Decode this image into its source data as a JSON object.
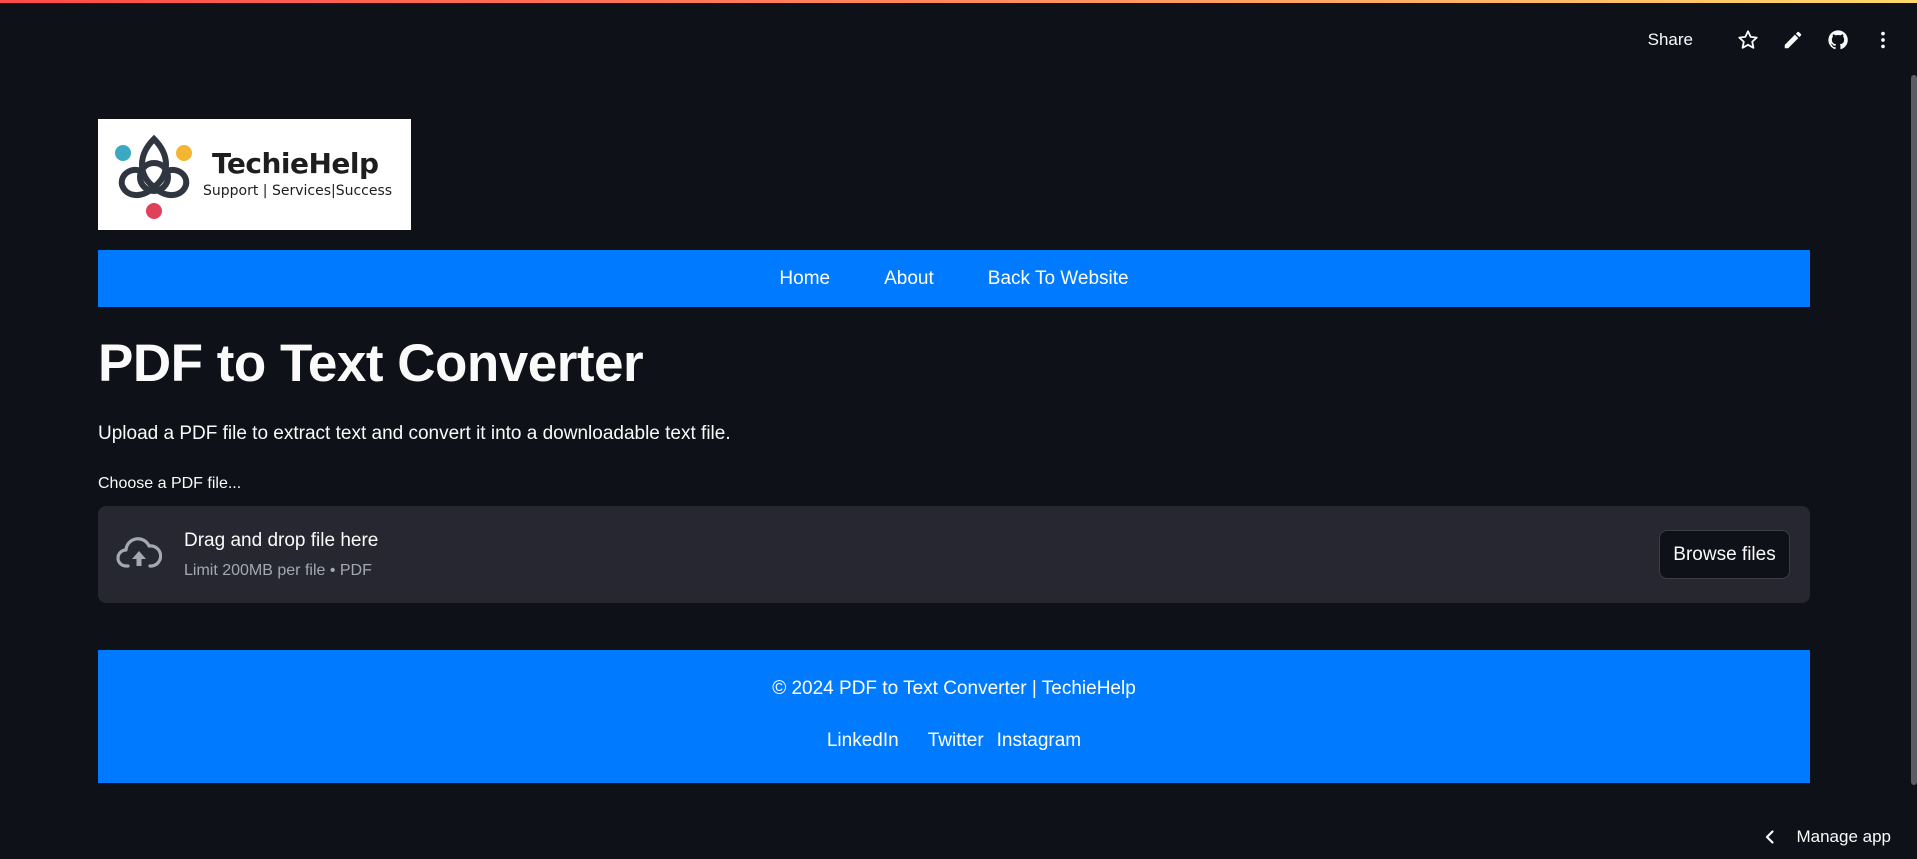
{
  "toolbar": {
    "share_label": "Share",
    "icons": [
      "star-icon",
      "pencil-icon",
      "github-icon",
      "more-vertical-icon"
    ]
  },
  "logo": {
    "name": "TechieHelp",
    "tagline": "Support | Services|Success"
  },
  "nav": {
    "items": [
      {
        "label": "Home"
      },
      {
        "label": "About"
      },
      {
        "label": "Back To Website"
      }
    ]
  },
  "main": {
    "title": "PDF to Text Converter",
    "subtitle": "Upload a PDF file to extract text and convert it into a downloadable text file."
  },
  "uploader": {
    "label": "Choose a PDF file...",
    "drop_text": "Drag and drop file here",
    "limit_text": "Limit 200MB per file • PDF",
    "browse_label": "Browse files",
    "icon": "cloud-upload-icon"
  },
  "footer": {
    "copyright": "© 2024 PDF to Text Converter | TechieHelp",
    "links": [
      {
        "label": "LinkedIn"
      },
      {
        "label": "Twitter"
      },
      {
        "label": "Instagram"
      }
    ]
  },
  "manage": {
    "label": "Manage app"
  },
  "colors": {
    "background": "#0e1117",
    "accent_blue": "#007bff",
    "dropzone": "#262730",
    "text": "#fafafa"
  }
}
